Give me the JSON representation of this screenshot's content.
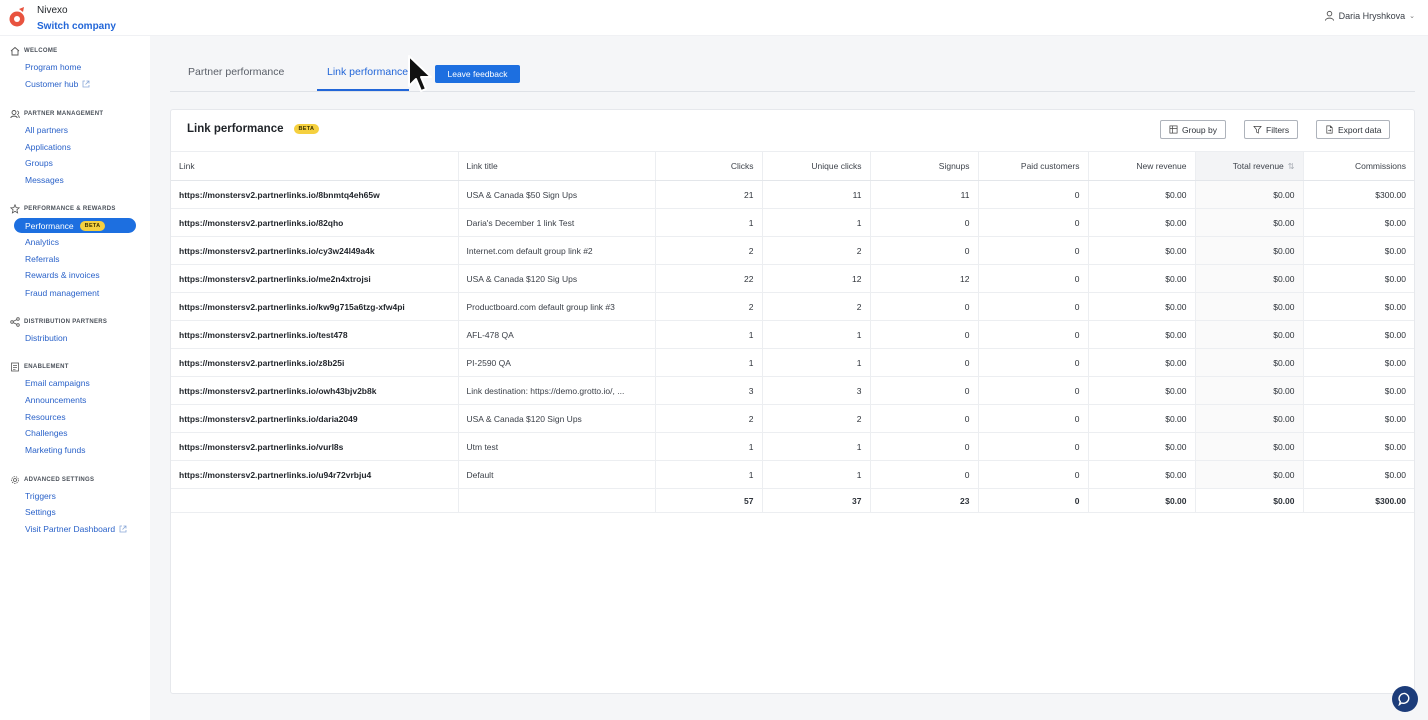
{
  "topbar": {
    "company_name": "Nivexo",
    "switch_company": "Switch company",
    "user_name": "Daria Hryshkova"
  },
  "sidebar": {
    "sections": [
      {
        "title": "WELCOME",
        "icon": "home-icon",
        "items": [
          {
            "label": "Program home"
          },
          {
            "label": "Customer hub",
            "external": true
          }
        ]
      },
      {
        "title": "PARTNER MANAGEMENT",
        "icon": "users-icon",
        "items": [
          {
            "label": "All partners"
          },
          {
            "label": "Applications"
          },
          {
            "label": "Groups"
          },
          {
            "label": "Messages"
          }
        ]
      },
      {
        "title": "PERFORMANCE & REWARDS",
        "icon": "star-icon",
        "items": [
          {
            "label": "Performance",
            "active": true,
            "badge": "BETA"
          },
          {
            "label": "Analytics"
          },
          {
            "label": "Referrals"
          },
          {
            "label": "Rewards & invoices"
          },
          {
            "label": "Fraud management"
          }
        ]
      },
      {
        "title": "DISTRIBUTION PARTNERS",
        "icon": "share-icon",
        "items": [
          {
            "label": "Distribution"
          }
        ]
      },
      {
        "title": "ENABLEMENT",
        "icon": "document-icon",
        "items": [
          {
            "label": "Email campaigns"
          },
          {
            "label": "Announcements"
          },
          {
            "label": "Resources"
          },
          {
            "label": "Challenges"
          },
          {
            "label": "Marketing funds"
          }
        ]
      },
      {
        "title": "ADVANCED SETTINGS",
        "icon": "gear-icon",
        "items": [
          {
            "label": "Triggers"
          },
          {
            "label": "Settings"
          },
          {
            "label": "Visit Partner Dashboard",
            "external": true
          }
        ]
      }
    ]
  },
  "tabs": [
    {
      "label": "Partner performance",
      "active": false
    },
    {
      "label": "Link performance",
      "active": true
    }
  ],
  "feedback_button": "Leave feedback",
  "card": {
    "title": "Link performance",
    "badge": "BETA",
    "group_by": "Group by",
    "filters": "Filters",
    "export": "Export data"
  },
  "table": {
    "columns": [
      "Link",
      "Link title",
      "Clicks",
      "Unique clicks",
      "Signups",
      "Paid customers",
      "New revenue",
      "Total revenue",
      "Commissions"
    ],
    "rows": [
      [
        "https://monstersv2.partnerlinks.io/8bnmtq4eh65w",
        "USA & Canada $50 Sign Ups",
        "21",
        "11",
        "11",
        "0",
        "$0.00",
        "$0.00",
        "$300.00"
      ],
      [
        "https://monstersv2.partnerlinks.io/82qho",
        "Daria's December 1 link Test",
        "1",
        "1",
        "0",
        "0",
        "$0.00",
        "$0.00",
        "$0.00"
      ],
      [
        "https://monstersv2.partnerlinks.io/cy3w24l49a4k",
        "Internet.com default group link #2",
        "2",
        "2",
        "0",
        "0",
        "$0.00",
        "$0.00",
        "$0.00"
      ],
      [
        "https://monstersv2.partnerlinks.io/me2n4xtrojsi",
        "USA & Canada $120 Sig Ups",
        "22",
        "12",
        "12",
        "0",
        "$0.00",
        "$0.00",
        "$0.00"
      ],
      [
        "https://monstersv2.partnerlinks.io/kw9g715a6tzg-xfw4pi",
        "Productboard.com default group link #3",
        "2",
        "2",
        "0",
        "0",
        "$0.00",
        "$0.00",
        "$0.00"
      ],
      [
        "https://monstersv2.partnerlinks.io/test478",
        "AFL-478 QA",
        "1",
        "1",
        "0",
        "0",
        "$0.00",
        "$0.00",
        "$0.00"
      ],
      [
        "https://monstersv2.partnerlinks.io/z8b25i",
        "PI-2590 QA",
        "1",
        "1",
        "0",
        "0",
        "$0.00",
        "$0.00",
        "$0.00"
      ],
      [
        "https://monstersv2.partnerlinks.io/owh43bjv2b8k",
        "Link destination: https://demo.grotto.io/, ...",
        "3",
        "3",
        "0",
        "0",
        "$0.00",
        "$0.00",
        "$0.00"
      ],
      [
        "https://monstersv2.partnerlinks.io/daria2049",
        "USA & Canada $120 Sign Ups",
        "2",
        "2",
        "0",
        "0",
        "$0.00",
        "$0.00",
        "$0.00"
      ],
      [
        "https://monstersv2.partnerlinks.io/vurl8s",
        "Utm test",
        "1",
        "1",
        "0",
        "0",
        "$0.00",
        "$0.00",
        "$0.00"
      ],
      [
        "https://monstersv2.partnerlinks.io/u94r72vrbju4",
        "Default",
        "1",
        "1",
        "0",
        "0",
        "$0.00",
        "$0.00",
        "$0.00"
      ]
    ],
    "totals": [
      "",
      "",
      "57",
      "37",
      "23",
      "0",
      "$0.00",
      "$0.00",
      "$300.00"
    ],
    "sorted_column": "Total revenue"
  },
  "colors": {
    "accent": "#1d6fe0",
    "link": "#2266d8",
    "badge": "#f5d03f",
    "chat": "#1c3c7a"
  }
}
